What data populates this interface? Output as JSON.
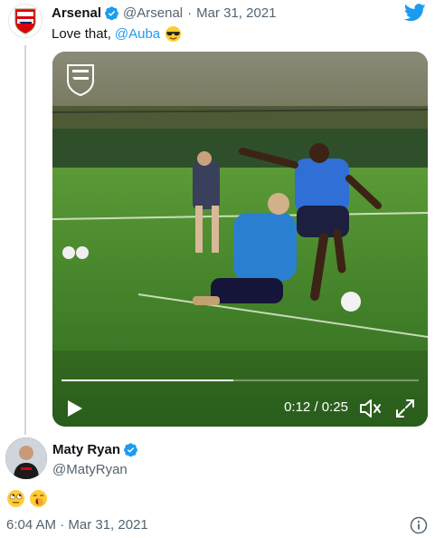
{
  "tweet": {
    "author_name": "Arsenal",
    "author_handle": "@Arsenal",
    "separator": "·",
    "date": "Mar 31, 2021",
    "text_prefix": "Love that,",
    "mention": "@Auba",
    "emoji": "sunglasses-emoji",
    "verified": true,
    "icons": [
      "arsenal-crest-icon",
      "verified-badge-icon",
      "twitter-bird-icon"
    ]
  },
  "video": {
    "current_time": "0:12",
    "time_separator": "/",
    "duration": "0:25",
    "progress_fraction": 0.48,
    "controls": [
      "play-icon",
      "volume-icon",
      "fullscreen-icon"
    ]
  },
  "reply": {
    "author_name": "Maty Ryan",
    "author_handle": "@MatyRyan",
    "verified": true,
    "emojis": [
      "rolling-eyes-emoji",
      "yawning-face-emoji"
    ]
  },
  "footer": {
    "timestamp": "6:04 AM · Mar 31, 2021",
    "info_icon": "info-icon"
  },
  "colors": {
    "accent": "#1d9bf0",
    "muted_text": "#536471",
    "thread_line": "#cfd9de"
  }
}
